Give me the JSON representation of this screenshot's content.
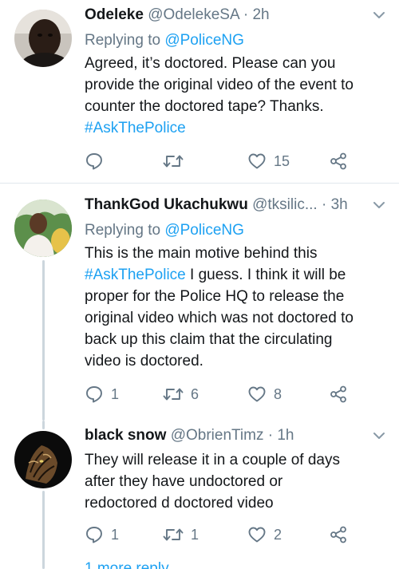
{
  "tweets": [
    {
      "name": "Odeleke",
      "handle": "@OdelekeSA",
      "separator": " · ",
      "time": "2h",
      "replying_prefix": "Replying to ",
      "replying_to": "@PoliceNG",
      "text_lines": [
        "Agreed, it’s doctored. Please can you",
        "provide the original video of the event to",
        "counter the doctored tape? Thanks."
      ],
      "hashtag": "#AskThePolice",
      "reply_count": "",
      "retweet_count": "",
      "like_count": "15"
    },
    {
      "name": "ThankGod Ukachukwu",
      "handle": "@tksilic...",
      "separator": " · ",
      "time": "3h",
      "replying_prefix": "Replying to ",
      "replying_to": "@PoliceNG",
      "line1": "This is the main motive behind this",
      "hashtag": "#AskThePolice",
      "line2_rest": " I guess. I think it will be",
      "text_lines": [
        "proper for the Police HQ to release the",
        "original video which was not doctored to",
        "back up this claim that the circulating",
        "video is doctored."
      ],
      "reply_count": "1",
      "retweet_count": "6",
      "like_count": "8"
    },
    {
      "name": "black snow",
      "handle": "@ObrienTimz",
      "separator": " · ",
      "time": "1h",
      "text_lines": [
        "They will release it in a couple of days",
        "after they have undoctored or",
        "redoctored d doctored video"
      ],
      "reply_count": "1",
      "retweet_count": "1",
      "like_count": "2"
    }
  ],
  "more_replies": "1 more reply",
  "colors": {
    "link": "#1da1f2",
    "secondary": "#657786",
    "divider": "#e1e8ed",
    "thread_line": "#ccd6dd"
  }
}
